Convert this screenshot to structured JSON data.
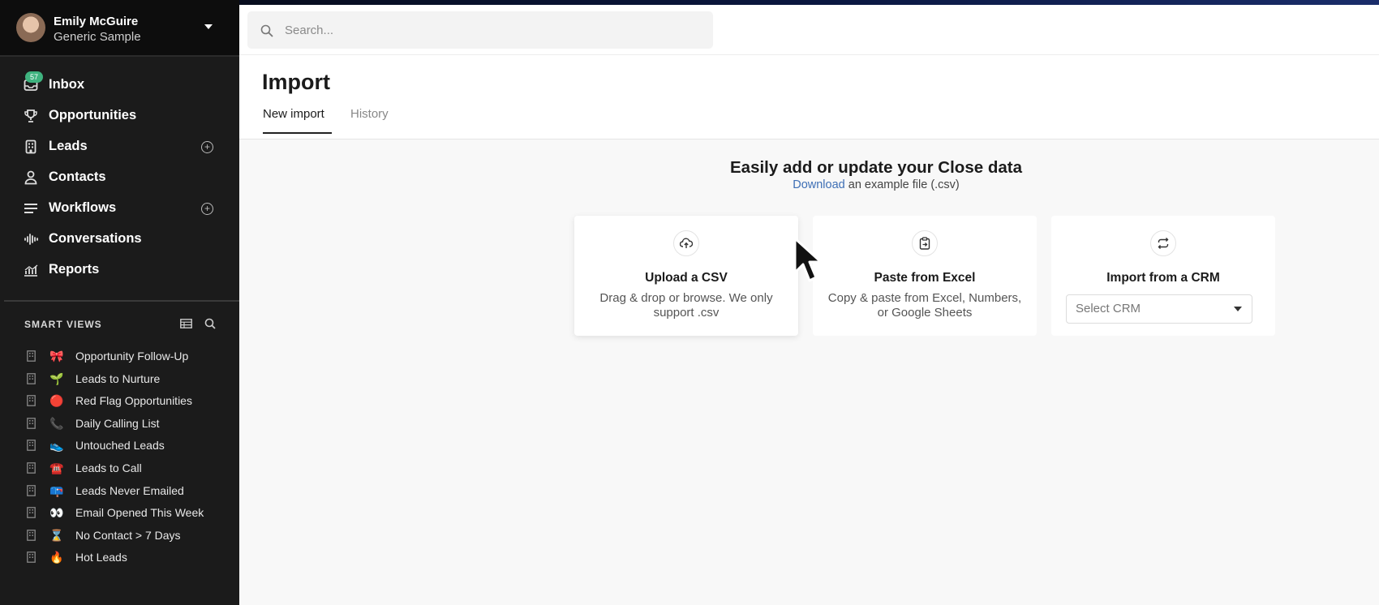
{
  "account": {
    "name": "Emily McGuire",
    "organization": "Generic Sample"
  },
  "nav": {
    "inbox": {
      "label": "Inbox",
      "badge": "57"
    },
    "opportunities": {
      "label": "Opportunities"
    },
    "leads": {
      "label": "Leads"
    },
    "contacts": {
      "label": "Contacts"
    },
    "workflows": {
      "label": "Workflows"
    },
    "conversations": {
      "label": "Conversations"
    },
    "reports": {
      "label": "Reports"
    }
  },
  "smart_views": {
    "header": "SMART VIEWS",
    "items": [
      {
        "label": "Opportunity Follow-Up",
        "emoji": "🎀"
      },
      {
        "label": "Leads to Nurture",
        "emoji": "🌱"
      },
      {
        "label": "Red Flag Opportunities",
        "emoji": "🔴"
      },
      {
        "label": "Daily Calling List",
        "emoji": "📞"
      },
      {
        "label": "Untouched Leads",
        "emoji": "👟"
      },
      {
        "label": "Leads to Call",
        "emoji": "☎️"
      },
      {
        "label": "Leads Never Emailed",
        "emoji": "📪"
      },
      {
        "label": "Email Opened This Week",
        "emoji": "👀"
      },
      {
        "label": "No Contact > 7 Days",
        "emoji": "⌛"
      },
      {
        "label": "Hot Leads",
        "emoji": "🔥"
      }
    ]
  },
  "search": {
    "placeholder": "Search..."
  },
  "page": {
    "title": "Import",
    "tabs": {
      "new_import": "New import",
      "history": "History"
    },
    "heading": "Easily add or update your Close data",
    "download_link": "Download",
    "download_rest": " an example file (.csv)"
  },
  "cards": {
    "csv": {
      "title": "Upload a CSV",
      "description": "Drag & drop or browse. We only support .csv"
    },
    "excel": {
      "title": "Paste from Excel",
      "description": "Copy & paste from Excel, Numbers, or Google Sheets"
    },
    "crm": {
      "title": "Import from a CRM",
      "select_value": "Select CRM"
    }
  },
  "colors": {
    "sidebar_bg": "#1b1b1b",
    "badge": "#3fb37f",
    "link": "#3e6fb5",
    "page_bg": "#f8f8f8"
  }
}
